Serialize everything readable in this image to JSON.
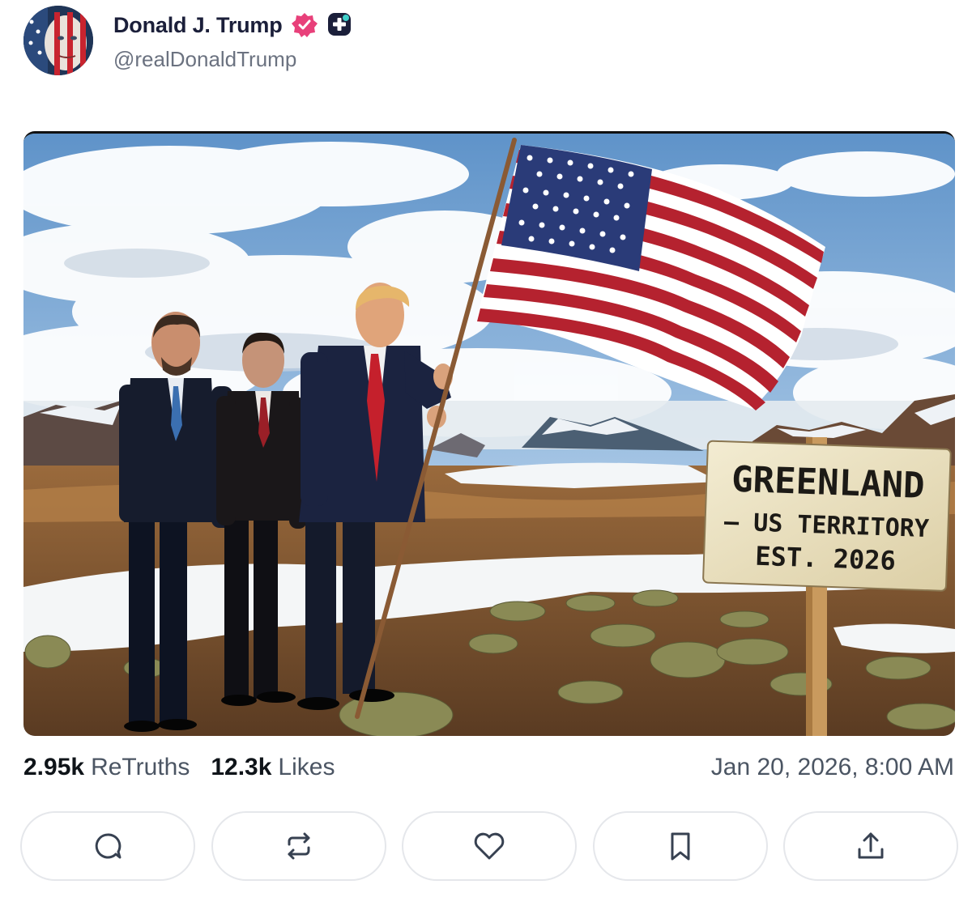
{
  "post": {
    "author": {
      "display_name": "Donald J. Trump",
      "handle": "@realDonaldTrump",
      "avatar_icon": "flag-face-avatar",
      "verified_badge_icon": "verified-badge-icon",
      "plus_badge_icon": "plus-badge-icon",
      "verified_color": "#e8407a"
    },
    "media": {
      "sign_line1": "GREENLAND",
      "sign_line2": "– US TERRITORY",
      "sign_line3": "EST. 2026"
    },
    "stats": {
      "retruths_count": "2.95k",
      "retruths_label": "ReTruths",
      "likes_count": "12.3k",
      "likes_label": "Likes"
    },
    "timestamp": "Jan 20, 2026, 8:00 AM",
    "actions": [
      {
        "name": "reply",
        "icon": "reply-icon"
      },
      {
        "name": "retruth",
        "icon": "retruth-icon"
      },
      {
        "name": "like",
        "icon": "heart-icon"
      },
      {
        "name": "bookmark",
        "icon": "bookmark-icon"
      },
      {
        "name": "share",
        "icon": "share-icon"
      }
    ]
  }
}
